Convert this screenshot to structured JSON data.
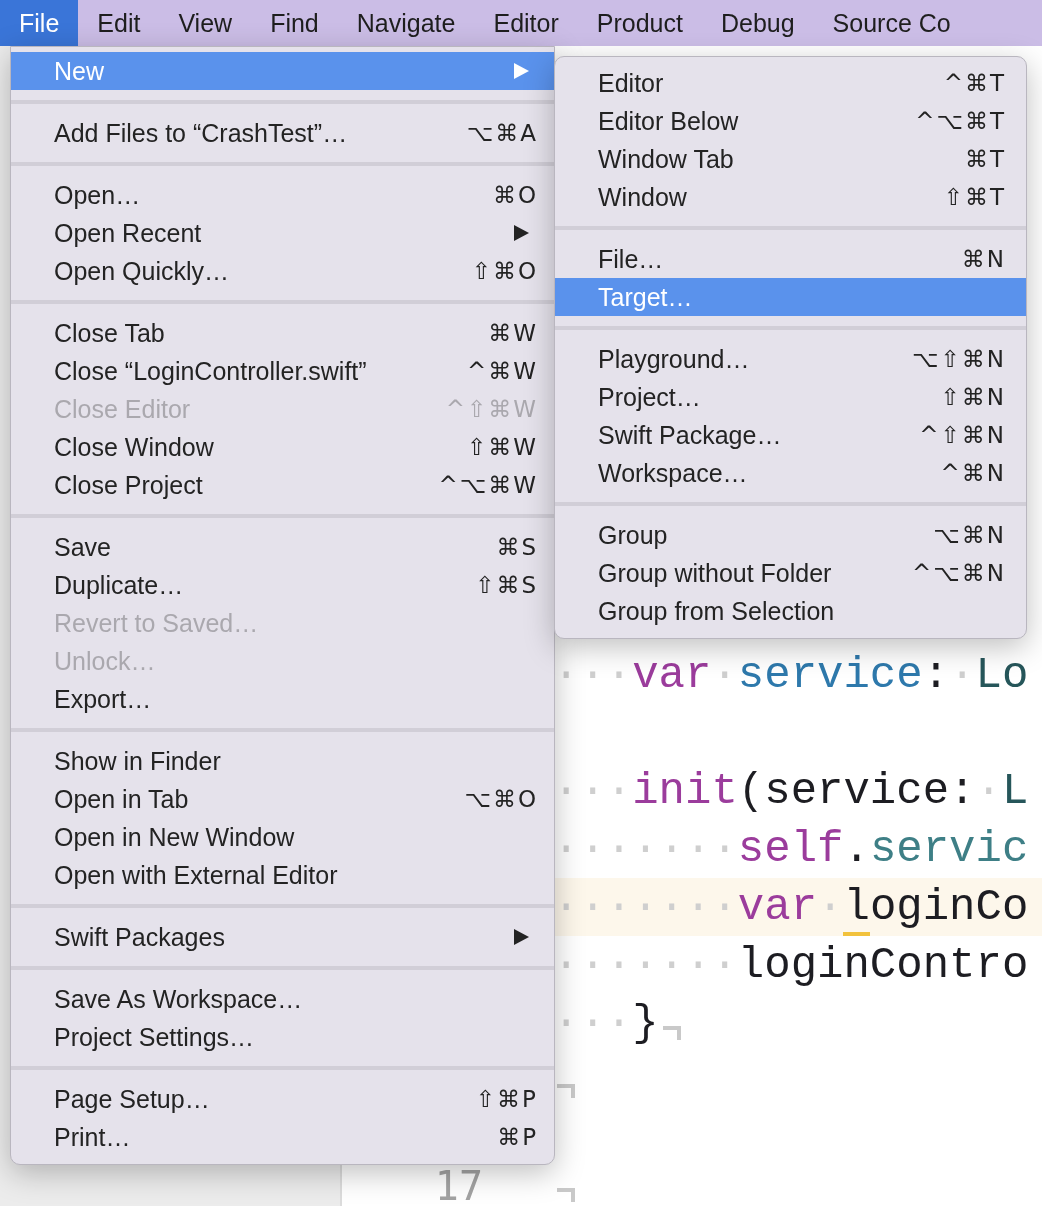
{
  "menu_bar": [
    {
      "label": "File",
      "selected": true
    },
    {
      "label": "Edit",
      "selected": false
    },
    {
      "label": "View",
      "selected": false
    },
    {
      "label": "Find",
      "selected": false
    },
    {
      "label": "Navigate",
      "selected": false
    },
    {
      "label": "Editor",
      "selected": false
    },
    {
      "label": "Product",
      "selected": false
    },
    {
      "label": "Debug",
      "selected": false
    },
    {
      "label": "Source Co",
      "selected": false
    }
  ],
  "editor": {
    "lines": [
      {
        "tokens": [
          {
            "kind": "invisible",
            "text": "···"
          },
          {
            "kind": "keyword",
            "text": "var"
          },
          {
            "kind": "invisible",
            "text": "·"
          },
          {
            "kind": "property",
            "text": "service"
          },
          {
            "kind": "plain",
            "text": ":"
          },
          {
            "kind": "invisible",
            "text": "·"
          },
          {
            "kind": "type",
            "text": "Lo"
          }
        ],
        "highlighted": false,
        "end_mark": false
      },
      {
        "highlighted": false,
        "end_mark": false
      },
      {
        "tokens": [
          {
            "kind": "invisible",
            "text": "···"
          },
          {
            "kind": "keyword",
            "text": "init"
          },
          {
            "kind": "plain",
            "text": "(service:"
          },
          {
            "kind": "invisible",
            "text": "·"
          },
          {
            "kind": "type",
            "text": "L"
          }
        ],
        "highlighted": false,
        "end_mark": false
      },
      {
        "tokens": [
          {
            "kind": "invisible",
            "text": "·······"
          },
          {
            "kind": "keyword",
            "text": "self"
          },
          {
            "kind": "plain",
            "text": "."
          },
          {
            "kind": "member",
            "text": "servic"
          }
        ],
        "highlighted": false,
        "end_mark": false
      },
      {
        "tokens": [
          {
            "kind": "invisible",
            "text": "·······"
          },
          {
            "kind": "keyword",
            "text": "var"
          },
          {
            "kind": "invisible",
            "text": "·"
          },
          {
            "kind": "marked",
            "text": "l"
          },
          {
            "kind": "plain",
            "text": "oginCo"
          }
        ],
        "highlighted": true,
        "end_mark": false
      },
      {
        "tokens": [
          {
            "kind": "invisible",
            "text": "·······"
          },
          {
            "kind": "plain",
            "text": "loginContro"
          }
        ],
        "highlighted": false,
        "end_mark": false
      },
      {
        "tokens": [
          {
            "kind": "invisible",
            "text": "···"
          },
          {
            "kind": "plain",
            "text": "}"
          }
        ],
        "highlighted": false,
        "end_mark": true
      },
      {
        "highlighted": false,
        "end_mark": true
      },
      {
        "highlighted": false,
        "end_mark": false
      },
      {
        "number": "17",
        "highlighted": false,
        "end_mark": true
      }
    ]
  },
  "file_menu": {
    "sections": [
      {
        "items": [
          {
            "label": "New",
            "has_submenu": true,
            "selected": true,
            "disabled": false
          }
        ]
      },
      {
        "items": [
          {
            "label": "Add Files to “CrashTest”…",
            "shortcut": "⌥⌘A",
            "has_submenu": false,
            "selected": false,
            "disabled": false
          }
        ]
      },
      {
        "items": [
          {
            "label": "Open…",
            "shortcut": "⌘O",
            "has_submenu": false,
            "selected": false,
            "disabled": false
          },
          {
            "label": "Open Recent",
            "has_submenu": true,
            "selected": false,
            "disabled": false
          },
          {
            "label": "Open Quickly…",
            "shortcut": "⇧⌘O",
            "has_submenu": false,
            "selected": false,
            "disabled": false
          }
        ]
      },
      {
        "items": [
          {
            "label": "Close Tab",
            "shortcut": "⌘W",
            "has_submenu": false,
            "selected": false,
            "disabled": false
          },
          {
            "label": "Close “LoginController.swift”",
            "shortcut": "^⌘W",
            "has_submenu": false,
            "selected": false,
            "disabled": false
          },
          {
            "label": "Close Editor",
            "shortcut": "^⇧⌘W",
            "has_submenu": false,
            "selected": false,
            "disabled": true
          },
          {
            "label": "Close Window",
            "shortcut": "⇧⌘W",
            "has_submenu": false,
            "selected": false,
            "disabled": false
          },
          {
            "label": "Close Project",
            "shortcut": "^⌥⌘W",
            "has_submenu": false,
            "selected": false,
            "disabled": false
          }
        ]
      },
      {
        "items": [
          {
            "label": "Save",
            "shortcut": "⌘S",
            "has_submenu": false,
            "selected": false,
            "disabled": false
          },
          {
            "label": "Duplicate…",
            "shortcut": "⇧⌘S",
            "has_submenu": false,
            "selected": false,
            "disabled": false
          },
          {
            "label": "Revert to Saved…",
            "has_submenu": false,
            "selected": false,
            "disabled": true
          },
          {
            "label": "Unlock…",
            "has_submenu": false,
            "selected": false,
            "disabled": true
          },
          {
            "label": "Export…",
            "has_submenu": false,
            "selected": false,
            "disabled": false
          }
        ]
      },
      {
        "items": [
          {
            "label": "Show in Finder",
            "has_submenu": false,
            "selected": false,
            "disabled": false
          },
          {
            "label": "Open in Tab",
            "shortcut": "⌥⌘O",
            "has_submenu": false,
            "selected": false,
            "disabled": false
          },
          {
            "label": "Open in New Window",
            "has_submenu": false,
            "selected": false,
            "disabled": false
          },
          {
            "label": "Open with External Editor",
            "has_submenu": false,
            "selected": false,
            "disabled": false
          }
        ]
      },
      {
        "items": [
          {
            "label": "Swift Packages",
            "has_submenu": true,
            "selected": false,
            "disabled": false
          }
        ]
      },
      {
        "items": [
          {
            "label": "Save As Workspace…",
            "has_submenu": false,
            "selected": false,
            "disabled": false
          },
          {
            "label": "Project Settings…",
            "has_submenu": false,
            "selected": false,
            "disabled": false
          }
        ]
      },
      {
        "items": [
          {
            "label": "Page Setup…",
            "shortcut": "⇧⌘P",
            "has_submenu": false,
            "selected": false,
            "disabled": false
          },
          {
            "label": "Print…",
            "shortcut": "⌘P",
            "has_submenu": false,
            "selected": false,
            "disabled": false
          }
        ]
      }
    ]
  },
  "new_submenu": {
    "sections": [
      {
        "items": [
          {
            "label": "Editor",
            "shortcut": "^⌘T",
            "selected": false
          },
          {
            "label": "Editor Below",
            "shortcut": "^⌥⌘T",
            "selected": false
          },
          {
            "label": "Window Tab",
            "shortcut": "⌘T",
            "selected": false
          },
          {
            "label": "Window",
            "shortcut": "⇧⌘T",
            "selected": false
          }
        ]
      },
      {
        "items": [
          {
            "label": "File…",
            "shortcut": "⌘N",
            "selected": false
          },
          {
            "label": "Target…",
            "selected": true
          }
        ]
      },
      {
        "items": [
          {
            "label": "Playground…",
            "shortcut": "⌥⇧⌘N",
            "selected": false
          },
          {
            "label": "Project…",
            "shortcut": "⇧⌘N",
            "selected": false
          },
          {
            "label": "Swift Package…",
            "shortcut": "^⇧⌘N",
            "selected": false
          },
          {
            "label": "Workspace…",
            "shortcut": "^⌘N",
            "selected": false
          }
        ]
      },
      {
        "items": [
          {
            "label": "Group",
            "shortcut": "⌥⌘N",
            "selected": false
          },
          {
            "label": "Group without Folder",
            "shortcut": "^⌥⌘N",
            "selected": false
          },
          {
            "label": "Group from Selection",
            "selected": false
          }
        ]
      }
    ]
  }
}
